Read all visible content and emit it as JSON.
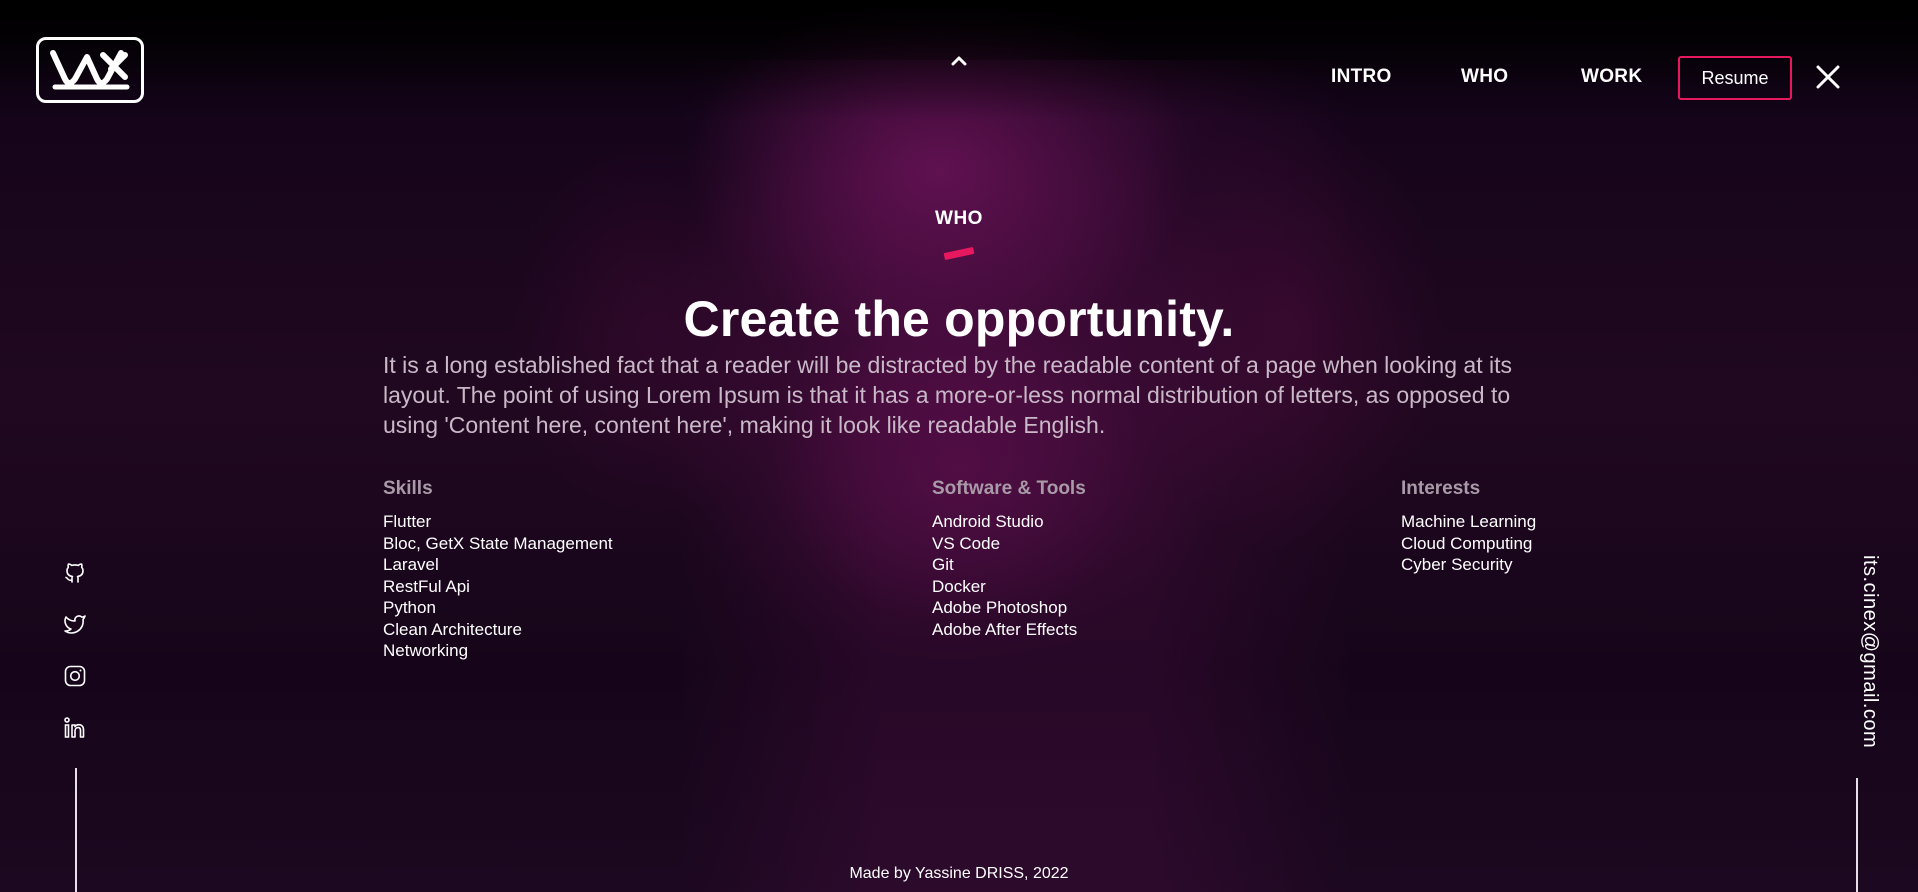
{
  "brand": {
    "logo_icon": "vx-logo",
    "accent_color": "#e8185f"
  },
  "header": {
    "scroll_up_icon": "chevron-up-icon",
    "nav": [
      {
        "label": "INTRO"
      },
      {
        "label": "WHO"
      },
      {
        "label": "WORK"
      }
    ],
    "resume_label": "Resume",
    "close_icon": "close-icon"
  },
  "section": {
    "tag": "WHO",
    "headline": "Create the opportunity.",
    "intro": "It is a long established fact that a reader will be distracted by the readable content of a page when looking at its layout. The point of using Lorem Ipsum is that it has a more-or-less normal distribution of letters, as opposed to using 'Content here, content here', making it look like readable English."
  },
  "columns": [
    {
      "title": "Skills",
      "items": [
        "Flutter",
        "Bloc, GetX State Management",
        "Laravel",
        "RestFul Api",
        "Python",
        "Clean Architecture",
        "Networking"
      ]
    },
    {
      "title": "Software & Tools",
      "items": [
        "Android Studio",
        "VS Code",
        "Git",
        "Docker",
        "Adobe Photoshop",
        "Adobe After Effects"
      ]
    },
    {
      "title": "Interests",
      "items": [
        "Machine Learning",
        "Cloud Computing",
        "Cyber Security"
      ]
    }
  ],
  "socials": [
    {
      "icon": "github-icon"
    },
    {
      "icon": "twitter-icon"
    },
    {
      "icon": "instagram-icon"
    },
    {
      "icon": "linkedin-icon"
    }
  ],
  "contact": {
    "email": "its.cinex@gmail.com"
  },
  "footer": {
    "credit": "Made by Yassine DRISS, 2022"
  }
}
